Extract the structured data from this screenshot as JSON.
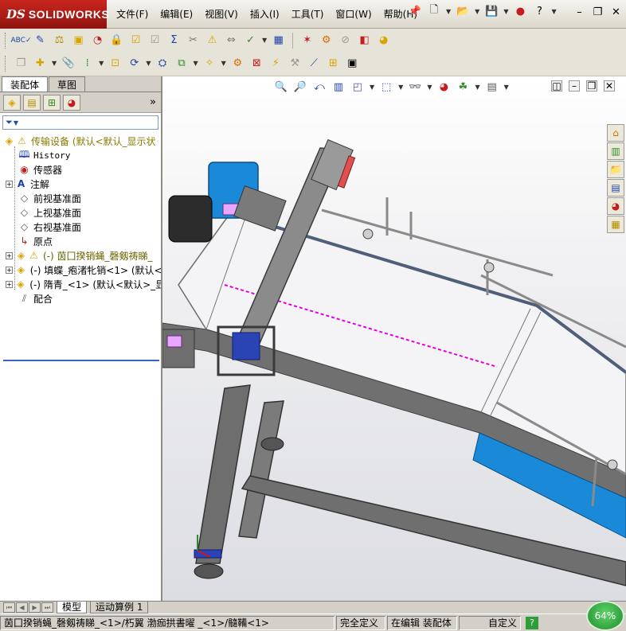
{
  "app": {
    "brand_ds": "DS",
    "brand_name": "SOLIDWORKS"
  },
  "menu": {
    "items": [
      "文件(F)",
      "编辑(E)",
      "视图(V)",
      "插入(I)",
      "工具(T)",
      "窗口(W)",
      "帮助(H)"
    ]
  },
  "panel": {
    "tabs": [
      "装配体",
      "草图"
    ],
    "more_glyph": "»",
    "filter_glyph": "▼"
  },
  "tree": {
    "root": "传输设备  (默认<默认_显示状",
    "items": [
      {
        "label": "History",
        "icon": "history-icon"
      },
      {
        "label": "传感器",
        "icon": "sensor-icon"
      },
      {
        "label": "注解",
        "icon": "annotation-icon",
        "expandable": true
      },
      {
        "label": "前视基准面",
        "icon": "plane-icon"
      },
      {
        "label": "上视基准面",
        "icon": "plane-icon"
      },
      {
        "label": "右视基准面",
        "icon": "plane-icon"
      },
      {
        "label": "原点",
        "icon": "origin-icon"
      },
      {
        "label": "(-) 茵囗揆销蝇_磬剱祷睇_",
        "icon": "part-icon",
        "expandable": true,
        "warn": true
      },
      {
        "label": "(-) 填蝶_疱渚牝销<1> (默认<",
        "icon": "part-icon",
        "expandable": true
      },
      {
        "label": "(-) 隋青_<1> (默认<默认>_显",
        "icon": "part-icon",
        "expandable": true
      },
      {
        "label": "配合",
        "icon": "mate-icon"
      }
    ]
  },
  "bottom_tabs": [
    "模型",
    "运动算例 1"
  ],
  "status": {
    "path": "茵囗揆销蝇_磬剱祷睇_<1>/朽翼 渤痂拱書曜  _<1>/髓鞴<1>",
    "definition": "完全定义",
    "mode": "在编辑 装配体",
    "custom": "自定义",
    "help": "?",
    "progress": "64%"
  },
  "colors": {
    "brand_red": "#b01c16",
    "accent_blue": "#1a8ad8",
    "frame_gray": "#6e6e6e",
    "sketch_magenta": "#e000e0"
  }
}
